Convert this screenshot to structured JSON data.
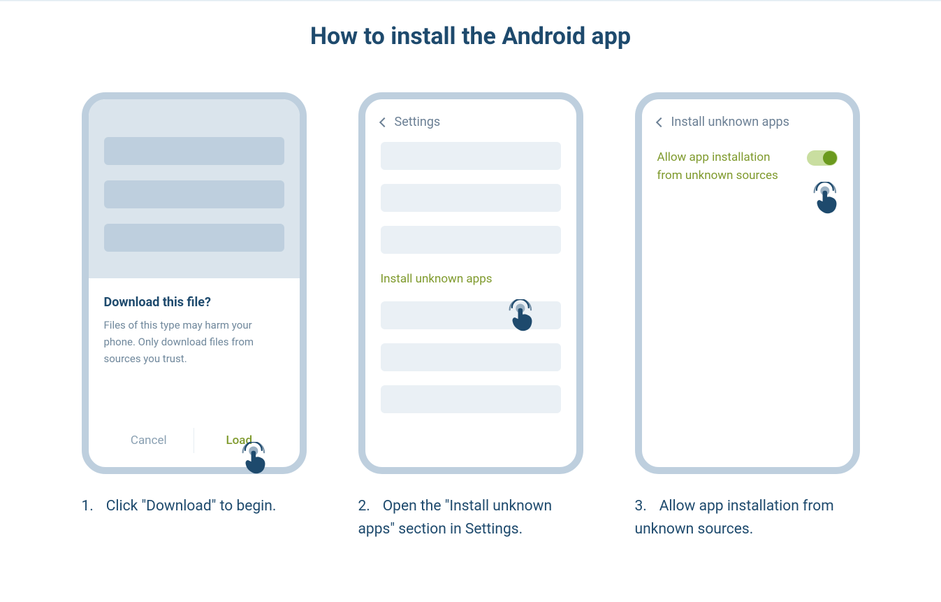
{
  "title": "How to install the Android app",
  "step1": {
    "dialog_title": "Download this file?",
    "dialog_body": "Files of this type may harm your phone. Only download files from sources you trust.",
    "cancel": "Cancel",
    "load": "Load",
    "caption_num": "1.",
    "caption_text": "Click \"Download\" to begin."
  },
  "step2": {
    "header": "Settings",
    "highlight": "Install unknown apps",
    "caption_num": "2.",
    "caption_text": "Open the \"Install unknown apps\" section in Settings."
  },
  "step3": {
    "header": "Install unknown apps",
    "toggle_label": "Allow app installation from unknown sources",
    "caption_num": "3.",
    "caption_text": "Allow app installation from unknown sources."
  }
}
